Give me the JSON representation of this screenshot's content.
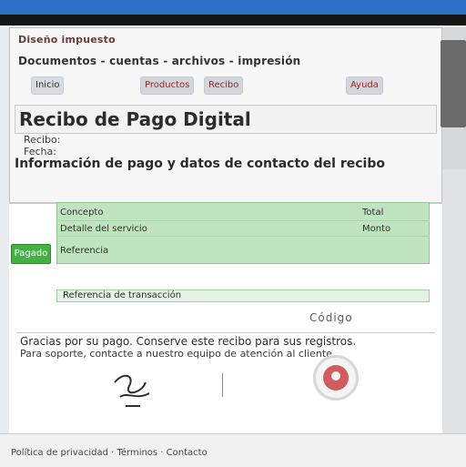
{
  "site": {
    "logo": "Diseño impuesto",
    "menu": "Documentos - cuentas - archivos - impresión"
  },
  "nav": {
    "chips": [
      "Inicio",
      "Productos",
      "Recibo",
      "Ayuda"
    ]
  },
  "page": {
    "title": "Recibo de Pago Digital",
    "meta1": "Recibo:",
    "meta2": "Fecha:",
    "subheading": "Información de pago y datos de contacto del recibo"
  },
  "panel": {
    "status_label": "Pagado",
    "green_row1_left": "Concepto",
    "green_row1_right": "Total",
    "green_row2_left": "Detalle del servicio",
    "green_row2_right": "Monto",
    "green_row3_left": "Referencia",
    "row_line_left": "",
    "row_line": "Referencia de transacción",
    "hint_right": "Código",
    "line1": "Gracias por su pago. Conserve este recibo para sus registros.",
    "line2": "Para soporte, contacte a nuestro equipo de atención al cliente."
  },
  "footer": {
    "text": "Política de privacidad · Términos · Contacto"
  },
  "colors": {
    "accent_blue": "#2b6fc7",
    "green_band": "#bfe4bf",
    "status_green": "#41b241",
    "badge_red": "#cc4b4b"
  },
  "icons": {
    "signature": "signature-icon",
    "seal": "seal-icon"
  }
}
